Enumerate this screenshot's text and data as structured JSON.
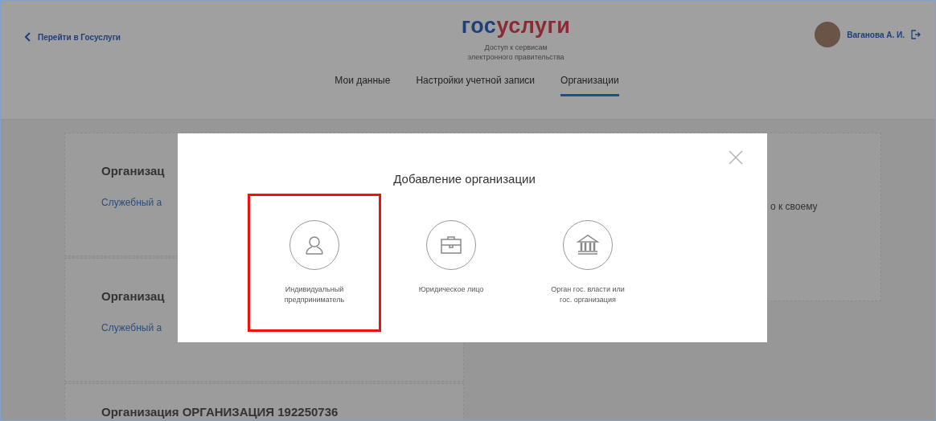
{
  "header": {
    "back_link": "Перейти в Госуслуги",
    "logo": {
      "part_1": "гос",
      "part_2": "услуги"
    },
    "subtitle": "Доступ к сервисам\nэлектронного правительства",
    "user_name": "Ваганова А. И."
  },
  "tabs": [
    {
      "label": "Мои данные",
      "selected": false
    },
    {
      "label": "Настройки учетной записи",
      "selected": false
    },
    {
      "label": "Организации",
      "selected": true
    }
  ],
  "cards": [
    {
      "title": "Организац",
      "link": "Служебный а"
    },
    {
      "title": "Организац",
      "link": "Служебный а"
    },
    {
      "title": "Организация ОРГАНИЗАЦИЯ 192250736"
    }
  ],
  "side_card": {
    "text": "о к своему"
  },
  "dialog": {
    "title": "Добавление организации",
    "options": [
      {
        "kind": "person",
        "label": "Индивидуальный\nпредприниматель",
        "highlighted": true
      },
      {
        "kind": "briefcase",
        "label": "Юридическое лицо",
        "highlighted": false
      },
      {
        "kind": "building",
        "label": "Орган гос. власти или\nгос. организация",
        "highlighted": false
      }
    ]
  }
}
